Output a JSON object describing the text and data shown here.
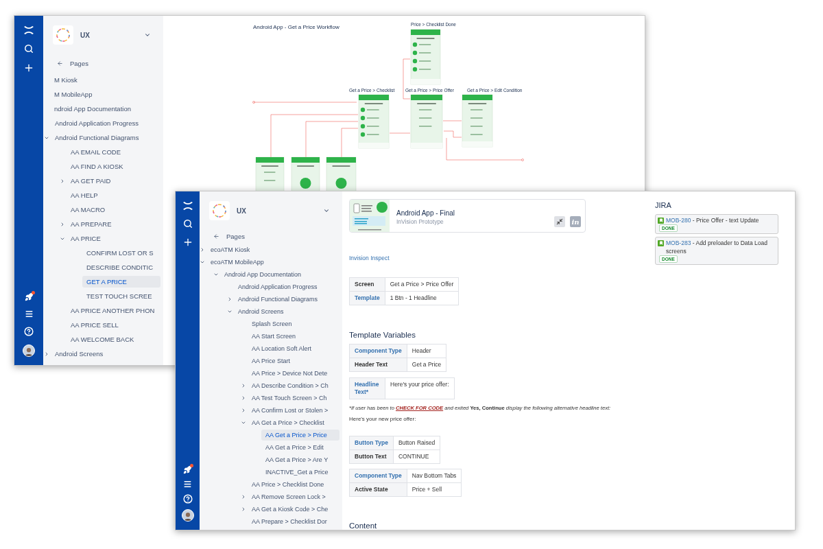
{
  "back_window": {
    "space": {
      "name": "UX"
    },
    "pages_label": "Pages",
    "tree": [
      {
        "label": "M Kiosk",
        "selected": false
      },
      {
        "label": "M MobileApp",
        "selected": false,
        "children": [
          {
            "label": "ndroid App Documentation",
            "selected": false,
            "children": [
              {
                "label": "Android Application Progress",
                "selected": false
              },
              {
                "label": "Android Functional Diagrams",
                "selected": false,
                "expanded": true,
                "children": [
                  {
                    "label": "AA EMAIL CODE",
                    "selected": false
                  },
                  {
                    "label": "AA FIND A KIOSK",
                    "selected": false
                  },
                  {
                    "label": "AA GET PAID",
                    "selected": false,
                    "expanded": false
                  },
                  {
                    "label": "AA HELP",
                    "selected": false
                  },
                  {
                    "label": "AA MACRO",
                    "selected": false
                  },
                  {
                    "label": "AA PREPARE",
                    "selected": false,
                    "expanded": false
                  },
                  {
                    "label": "AA PRICE",
                    "selected": false,
                    "expanded": true,
                    "children": [
                      {
                        "label": "CONFIRM LOST OR S",
                        "selected": false
                      },
                      {
                        "label": "DESCRIBE CONDITIC",
                        "selected": false
                      },
                      {
                        "label": "GET A PRICE",
                        "selected": true
                      },
                      {
                        "label": "TEST TOUCH SCREE",
                        "selected": false
                      }
                    ]
                  },
                  {
                    "label": "AA PRICE ANOTHER PHON",
                    "selected": false
                  },
                  {
                    "label": "AA PRICE SELL",
                    "selected": false
                  },
                  {
                    "label": "AA WELCOME BACK",
                    "selected": false
                  }
                ]
              },
              {
                "label": "Android Screens",
                "selected": false,
                "expanded": false
              }
            ]
          }
        ]
      }
    ],
    "diagram": {
      "title": "Android App - Get a Price Workflow",
      "screens": [
        {
          "title": "Price > Checklist Done"
        },
        {
          "title": "Get a Price > Checklist"
        },
        {
          "title": "Get a Price > Price Offer"
        },
        {
          "title": "Get a Price > Edit Condition"
        }
      ]
    }
  },
  "front_window": {
    "space": {
      "name": "UX"
    },
    "pages_label": "Pages",
    "tree": [
      {
        "label": "ecoATM Kiosk",
        "selected": false,
        "expanded": false
      },
      {
        "label": "ecoATM MobileApp",
        "selected": false,
        "expanded": true,
        "children": [
          {
            "label": "Android App Documentation",
            "selected": false,
            "expanded": true,
            "children": [
              {
                "label": "Android Application Progress",
                "selected": false
              },
              {
                "label": "Android Functional Diagrams",
                "selected": false,
                "expanded": false
              },
              {
                "label": "Android Screens",
                "selected": false,
                "expanded": true,
                "children": [
                  {
                    "label": "Splash Screen",
                    "selected": false
                  },
                  {
                    "label": "AA Start Screen",
                    "selected": false
                  },
                  {
                    "label": "AA Location Soft Alert",
                    "selected": false
                  },
                  {
                    "label": "AA Price Start",
                    "selected": false
                  },
                  {
                    "label": "AA Price > Device Not Dete",
                    "selected": false
                  },
                  {
                    "label": "AA Describe Condition > Ch",
                    "selected": false,
                    "expanded": false
                  },
                  {
                    "label": "AA Test Touch Screen > Ch",
                    "selected": false,
                    "expanded": false
                  },
                  {
                    "label": "AA Confirm Lost or Stolen >",
                    "selected": false,
                    "expanded": false
                  },
                  {
                    "label": "AA Get a Price > Checklist",
                    "selected": false,
                    "expanded": true,
                    "children": [
                      {
                        "label": "AA Get a Price > Price",
                        "selected": true
                      },
                      {
                        "label": "AA Get a Price > Edit",
                        "selected": false
                      },
                      {
                        "label": "AA Get a Price > Are Y",
                        "selected": false
                      },
                      {
                        "label": "INACTIVE_Get a Price",
                        "selected": false
                      }
                    ]
                  },
                  {
                    "label": "AA Price > Checklist Done",
                    "selected": false
                  },
                  {
                    "label": "AA Remove Screen Lock >",
                    "selected": false,
                    "expanded": false
                  },
                  {
                    "label": "AA Get a Kiosk Code > Che",
                    "selected": false,
                    "expanded": false
                  },
                  {
                    "label": "AA Prepare > Checklist Dor",
                    "selected": false
                  }
                ]
              }
            ]
          }
        ]
      }
    ],
    "prototype": {
      "title": "Android App - Final",
      "subtitle": "InVision Prototype",
      "logo": "in"
    },
    "inspect_link": "Invision Inspect",
    "screen_table": [
      {
        "label": "Screen",
        "kind": "plain",
        "value": "Get a Price > Price Offer"
      },
      {
        "label": "Template",
        "kind": "link",
        "value": "1 Btn - 1 Headline"
      }
    ],
    "template_variables": {
      "heading": "Template Variables",
      "tables": [
        [
          {
            "label": "Component Type",
            "kind": "link",
            "value": "Header"
          },
          {
            "label": "Header Text",
            "kind": "plain",
            "value": "Get a Price"
          }
        ],
        [
          {
            "label": "Headline Text*",
            "kind": "link",
            "value": "Here's your price offer:"
          }
        ]
      ],
      "note": [
        {
          "kind": "plain",
          "text": "*If user has been to "
        },
        {
          "kind": "link",
          "text": "CHECK FOR CODE"
        },
        {
          "kind": "plain",
          "text": " and exited "
        },
        {
          "kind": "bold",
          "text": "Yes, Continue"
        },
        {
          "kind": "plain",
          "text": " display the following alternative headline text:"
        }
      ],
      "alt_text": "Here's your new price offer:",
      "more_tables": [
        [
          {
            "label": "Button Type",
            "kind": "link",
            "value": "Button Raised"
          },
          {
            "label": "Button Text",
            "kind": "plain",
            "value": "CONTINUE"
          }
        ],
        [
          {
            "label": "Component Type",
            "kind": "link",
            "value": "Nav Bottom Tabs"
          },
          {
            "label": "Active State",
            "kind": "plain",
            "value": "Price + Sell"
          }
        ]
      ]
    },
    "content_heading": "Content",
    "jira": {
      "heading": "JIRA",
      "issues": [
        {
          "key": "MOB-280",
          "summary": "- Price Offer - text Update",
          "status": "DONE"
        },
        {
          "key": "MOB-283",
          "summary": "- Add preloader to Data Load screens",
          "status": "DONE"
        }
      ]
    }
  }
}
